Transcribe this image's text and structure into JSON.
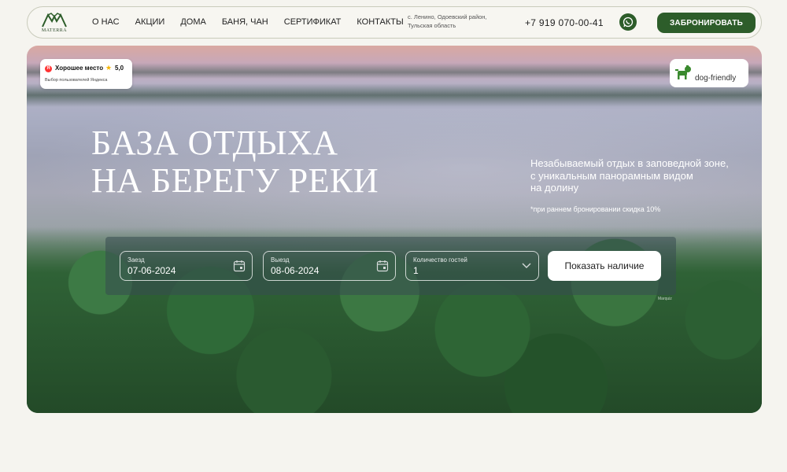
{
  "header": {
    "logo_text": "MATERRA",
    "nav": [
      "О НАС",
      "АКЦИИ",
      "ДОМА",
      "БАНЯ, ЧАН",
      "СЕРТИФИКАТ",
      "КОНТАКТЫ"
    ],
    "address": "с. Ленино, Одоевский район, Тульская область",
    "phone": "+7 919 070-00-41",
    "book_label": "ЗАБРОНИРОВАТЬ",
    "accent_color": "#2d5d2a"
  },
  "badges": {
    "yandex_logo": "Я",
    "yandex_title": "Хорошее место",
    "yandex_rating": "5,0",
    "yandex_sub": "Выбор пользователей Яндекса",
    "dog_label": "dog-friendly"
  },
  "hero": {
    "title_line1": "БАЗА ОТДЫХА",
    "title_line2": "НА БЕРЕГУ РЕКИ",
    "desc_line1": "Незабываемый отдых в заповедной зоне,",
    "desc_line2": "с уникальным панорамным видом",
    "desc_line3": "на долину",
    "note": "*при раннем бронировании скидка 10%"
  },
  "booking": {
    "checkin_label": "Заезд",
    "checkin_value": "07-06-2024",
    "checkout_label": "Выезд",
    "checkout_value": "08-06-2024",
    "guests_label": "Количество гостей",
    "guests_value": "1",
    "submit_label": "Показать наличие"
  },
  "footer_mark": "Marquiz"
}
